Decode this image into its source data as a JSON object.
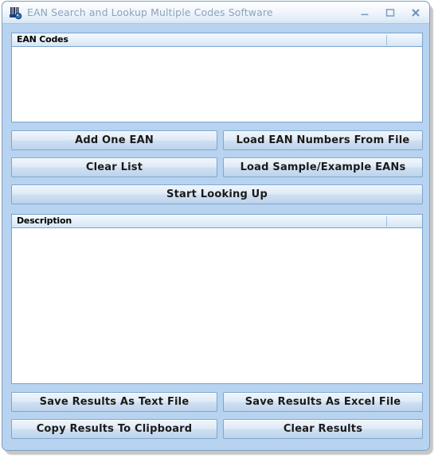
{
  "window": {
    "title": "EAN Search and Lookup Multiple Codes Software",
    "icon": "barcode-app-icon",
    "controls": {
      "minimize": "minimize-icon",
      "maximize": "maximize-icon",
      "close": "close-icon"
    }
  },
  "colors": {
    "client_background": "#b7d3ef",
    "window_border": "#7d9cc0",
    "titlebar_text": "#8ca3bd",
    "grid_border": "#7aa3cc",
    "button_border": "#7fa6cd",
    "grid_body": "#ffffff"
  },
  "ean_list": {
    "column_header": "EAN Codes",
    "rows": []
  },
  "results_list": {
    "column_header": "Description",
    "rows": []
  },
  "buttons": {
    "add_one_ean": "Add One EAN",
    "load_ean_numbers_from_file": "Load EAN Numbers From File",
    "clear_list": "Clear List",
    "load_sample_example_eans": "Load Sample/Example EANs",
    "start_looking_up": "Start Looking Up",
    "save_results_as_text_file": "Save Results As Text File",
    "save_results_as_excel_file": "Save Results As Excel File",
    "copy_results_to_clipboard": "Copy Results To Clipboard",
    "clear_results": "Clear Results"
  }
}
